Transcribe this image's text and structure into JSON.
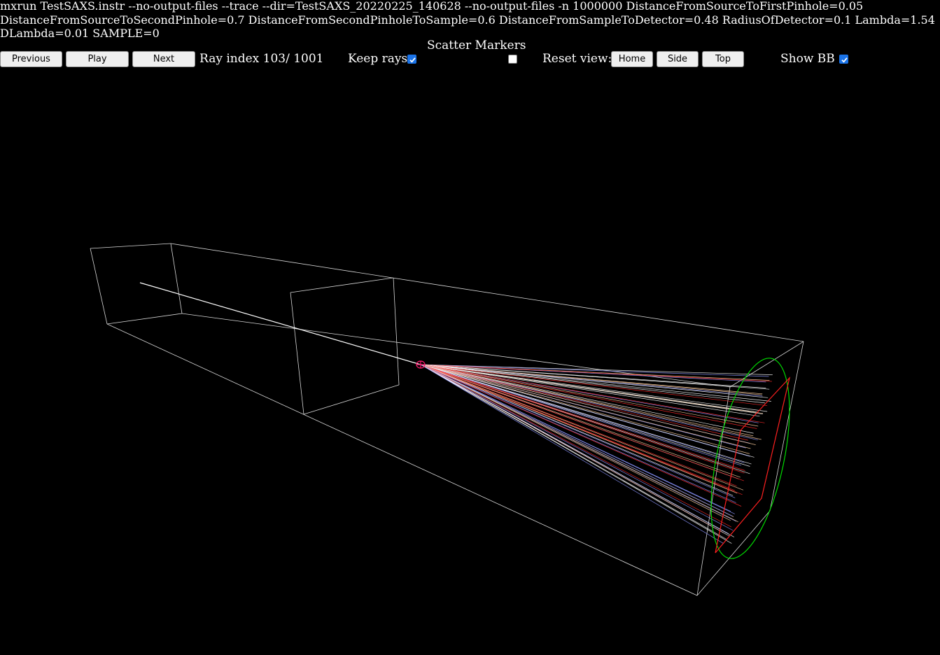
{
  "command": {
    "line1": "mxrun TestSAXS.instr --no-output-files --trace --dir=TestSAXS_20220225_140628 --no-output-files -n 1000000 DistanceFromSourceToFirstPinhole=0.05",
    "line2": "DistanceFromSourceToSecondPinhole=0.7 DistanceFromSecondPinholeToSample=0.6 DistanceFromSampleToDetector=0.48 RadiusOfDetector=0.1 Lambda=1.54",
    "line3": "DLambda=0.01 SAMPLE=0"
  },
  "controls": {
    "previous_label": "Previous",
    "play_label": "Play",
    "next_label": "Next",
    "ray_index_label": "Ray index 103/ 1001",
    "keep_rays_label": "Keep rays",
    "keep_rays_checked": true,
    "scatter_markers_label": "Scatter Markers",
    "scatter_markers_checked": false,
    "reset_view_label": "Reset view:",
    "home_label": "Home",
    "side_label": "Side",
    "top_label": "Top",
    "show_bb_label": "Show BB",
    "show_bb_checked": true
  },
  "colors": {
    "background": "#000000",
    "text": "#ffffff",
    "bounding_box": "#ffffff",
    "detector_circle": "#00dd00",
    "detector_square": "#ff2020",
    "sample_marker": "#ff1a6e",
    "checkbox_accent": "#1a73e8",
    "ray_colors": [
      "#ffffff",
      "#ff2a2a",
      "#8c96ff",
      "#ffd0a0"
    ]
  },
  "scene": {
    "ray_count_shown": 103
  }
}
